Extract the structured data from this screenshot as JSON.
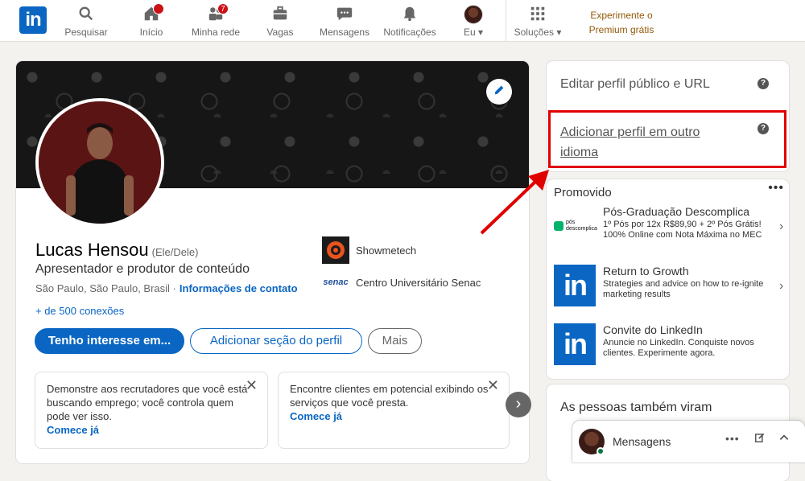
{
  "nav": {
    "items": [
      {
        "label": "Pesquisar",
        "icon": "search-icon"
      },
      {
        "label": "Início",
        "icon": "home-icon"
      },
      {
        "label": "Minha rede",
        "icon": "network-icon"
      },
      {
        "label": "Vagas",
        "icon": "briefcase-icon"
      },
      {
        "label": "Mensagens",
        "icon": "messaging-icon"
      },
      {
        "label": "Notificações",
        "icon": "bell-icon"
      },
      {
        "label": "Eu",
        "icon": "avatar"
      },
      {
        "label": "Soluções",
        "icon": "grid-icon"
      }
    ],
    "home_badge": "",
    "network_badge": "7",
    "premium_line1": "Experimente o",
    "premium_line2": "Premium grátis",
    "logo_text": "in"
  },
  "profile": {
    "name": "Lucas Hensou",
    "pronoun": "(Ele/Dele)",
    "headline": "Apresentador e produtor de conteúdo",
    "location": "São Paulo, São Paulo, Brasil ·",
    "contact_link": "Informações de contato",
    "connections": "+ de 500 conexões",
    "orgs": [
      {
        "name": "Showmetech",
        "icon": "showmetech-logo"
      },
      {
        "name": "Centro Universitário Senac",
        "icon": "senac-logo"
      }
    ],
    "senac_logo_text": "senac",
    "buttons": {
      "primary": "Tenho interesse em...",
      "secondary": "Adicionar seção do perfil",
      "more": "Mais"
    },
    "suggestions": [
      {
        "text": "Demonstre aos recrutadores que você está buscando emprego; você controla quem pode ver isso.",
        "link": "Comece já"
      },
      {
        "text": "Encontre clientes em potencial exibindo os serviços que você presta.",
        "link": "Comece já"
      }
    ]
  },
  "right": {
    "edit_public": "Editar perfil público e URL",
    "add_language": "Adicionar perfil em outro idioma",
    "promoted_title": "Promovido",
    "ads": [
      {
        "title": "Pós-Graduação Descomplica",
        "body": "1º Pós por 12x R$89,90 + 2º Pós Grátis! 100% Online com Nota Máxima no MEC",
        "logo_text": "pós descomplica"
      },
      {
        "title": "Return to Growth",
        "body": "Strategies and advice on how to re-ignite marketing results",
        "logo_text": "in"
      },
      {
        "title": "Convite do LinkedIn",
        "body": "Anuncie no LinkedIn. Conquiste novos clientes. Experimente agora.",
        "logo_text": "in"
      }
    ],
    "people_also_viewed": "As pessoas também viram",
    "messaging_label": "Mensagens"
  },
  "colors": {
    "brand": "#0a66c2",
    "highlight": "#e00000",
    "premium": "#915907"
  }
}
